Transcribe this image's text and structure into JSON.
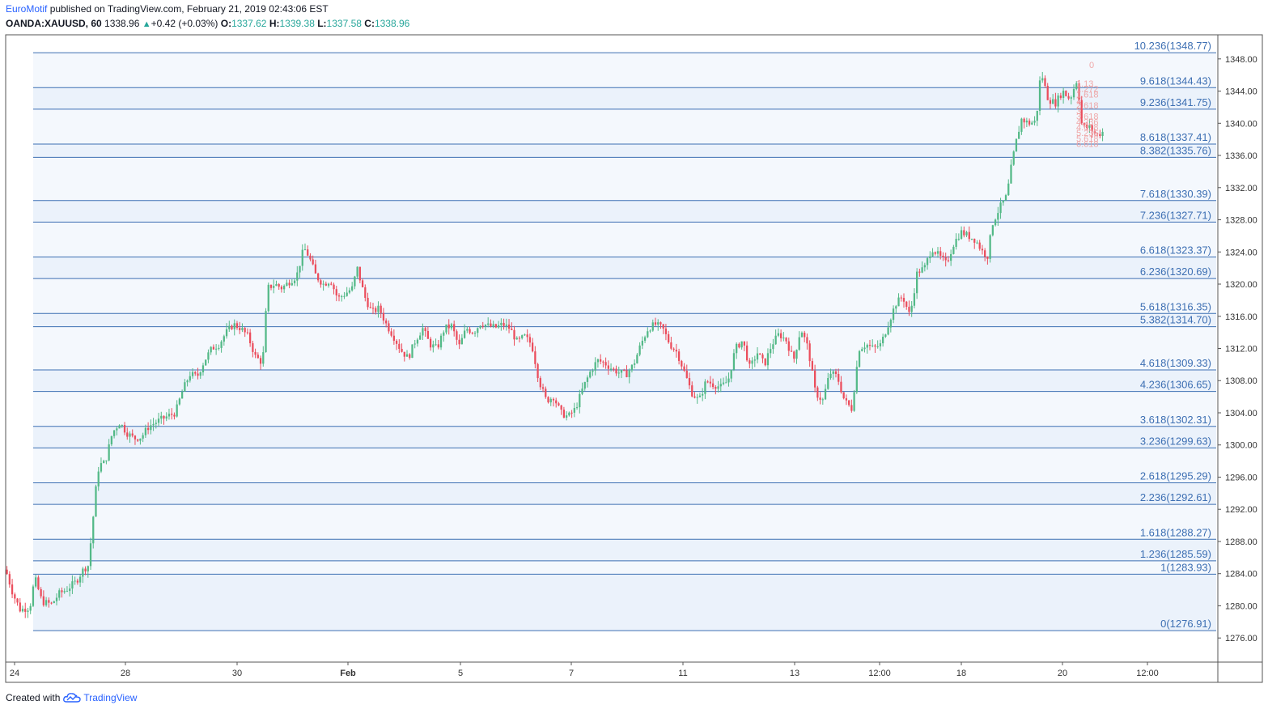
{
  "header": {
    "author": "EuroMotif",
    "published_text": " published on TradingView.com, February 21, 2019 02:43:06 EST",
    "symbol": "OANDA:XAUUSD, 60",
    "last": "1338.96",
    "change_arrow": "▲",
    "change": "+0.42 (+0.03%)",
    "o_label": "O:",
    "o": "1337.62",
    "h_label": "H:",
    "h": "1339.38",
    "l_label": "L:",
    "l": "1337.58",
    "c_label": "C:",
    "c": "1338.96"
  },
  "footer": {
    "created_with": "Created with",
    "brand": "TradingView"
  },
  "chart_data": {
    "type": "candlestick",
    "symbol": "OANDA:XAUUSD",
    "timeframe": "60",
    "ylim": [
      1273,
      1351
    ],
    "y_ticks": [
      "1276.00",
      "1280.00",
      "1284.00",
      "1288.00",
      "1292.00",
      "1296.00",
      "1300.00",
      "1304.00",
      "1308.00",
      "1312.00",
      "1316.00",
      "1320.00",
      "1324.00",
      "1328.00",
      "1332.00",
      "1336.00",
      "1340.00",
      "1344.00",
      "1348.00"
    ],
    "x_ticks": [
      "24",
      "28",
      "30",
      "Feb",
      "5",
      "7",
      "11",
      "13",
      "12:00",
      "18",
      "20",
      "12:00"
    ],
    "colors": {
      "up": "#53b987",
      "down": "#eb4d5c",
      "fib_line": "#3d6fb3",
      "fib_label": "#3d6fb3",
      "fib_fill": "#dbe8f7",
      "small_fib": "#ef9a9a"
    },
    "fib_levels": [
      {
        "ratio": "0",
        "price": 1276.91,
        "label": "0(1276.91)"
      },
      {
        "ratio": "1",
        "price": 1283.93,
        "label": "1(1283.93)"
      },
      {
        "ratio": "1.236",
        "price": 1285.59,
        "label": "1.236(1285.59)"
      },
      {
        "ratio": "1.618",
        "price": 1288.27,
        "label": "1.618(1288.27)"
      },
      {
        "ratio": "2.236",
        "price": 1292.61,
        "label": "2.236(1292.61)"
      },
      {
        "ratio": "2.618",
        "price": 1295.29,
        "label": "2.618(1295.29)"
      },
      {
        "ratio": "3.236",
        "price": 1299.63,
        "label": "3.236(1299.63)"
      },
      {
        "ratio": "3.618",
        "price": 1302.31,
        "label": "3.618(1302.31)"
      },
      {
        "ratio": "4.236",
        "price": 1306.65,
        "label": "4.236(1306.65)"
      },
      {
        "ratio": "4.618",
        "price": 1309.33,
        "label": "4.618(1309.33)"
      },
      {
        "ratio": "5.382",
        "price": 1314.7,
        "label": "5.382(1314.70)"
      },
      {
        "ratio": "5.618",
        "price": 1316.35,
        "label": "5.618(1316.35)"
      },
      {
        "ratio": "6.236",
        "price": 1320.69,
        "label": "6.236(1320.69)"
      },
      {
        "ratio": "6.618",
        "price": 1323.37,
        "label": "6.618(1323.37)"
      },
      {
        "ratio": "7.236",
        "price": 1327.71,
        "label": "7.236(1327.71)"
      },
      {
        "ratio": "7.618",
        "price": 1330.39,
        "label": "7.618(1330.39)"
      },
      {
        "ratio": "8.382",
        "price": 1335.76,
        "label": "8.382(1335.76)"
      },
      {
        "ratio": "8.618",
        "price": 1337.41,
        "label": "8.618(1337.41)"
      },
      {
        "ratio": "9.236",
        "price": 1341.75,
        "label": "9.236(1341.75)"
      },
      {
        "ratio": "9.618",
        "price": 1344.43,
        "label": "9.618(1344.43)"
      },
      {
        "ratio": "10.236",
        "price": 1348.77,
        "label": "10.236(1348.77)"
      }
    ],
    "small_fib_labels": [
      "0",
      "1.13",
      "1.272",
      "1.618",
      "2",
      "2.618",
      "3",
      "3.618",
      "4.236",
      "4.618",
      "5.236",
      "5.618",
      "6.618"
    ],
    "price_path": [
      {
        "x": 0.0,
        "y": 1284.5
      },
      {
        "x": 0.006,
        "y": 1281.5
      },
      {
        "x": 0.012,
        "y": 1279.5
      },
      {
        "x": 0.02,
        "y": 1279.8
      },
      {
        "x": 0.024,
        "y": 1283.5
      },
      {
        "x": 0.03,
        "y": 1280.5
      },
      {
        "x": 0.038,
        "y": 1280.2
      },
      {
        "x": 0.044,
        "y": 1281.5
      },
      {
        "x": 0.05,
        "y": 1282.0
      },
      {
        "x": 0.058,
        "y": 1283.0
      },
      {
        "x": 0.064,
        "y": 1284.5
      },
      {
        "x": 0.068,
        "y": 1285.0
      },
      {
        "x": 0.071,
        "y": 1289.0
      },
      {
        "x": 0.074,
        "y": 1294.0
      },
      {
        "x": 0.077,
        "y": 1297.5
      },
      {
        "x": 0.082,
        "y": 1297.8
      },
      {
        "x": 0.088,
        "y": 1301.5
      },
      {
        "x": 0.094,
        "y": 1302.8
      },
      {
        "x": 0.1,
        "y": 1301.5
      },
      {
        "x": 0.106,
        "y": 1300.8
      },
      {
        "x": 0.112,
        "y": 1301.0
      },
      {
        "x": 0.118,
        "y": 1302.3
      },
      {
        "x": 0.126,
        "y": 1303.0
      },
      {
        "x": 0.134,
        "y": 1303.6
      },
      {
        "x": 0.14,
        "y": 1304.0
      },
      {
        "x": 0.146,
        "y": 1306.8
      },
      {
        "x": 0.152,
        "y": 1308.8
      },
      {
        "x": 0.158,
        "y": 1308.5
      },
      {
        "x": 0.164,
        "y": 1310.5
      },
      {
        "x": 0.17,
        "y": 1312.0
      },
      {
        "x": 0.176,
        "y": 1312.5
      },
      {
        "x": 0.182,
        "y": 1314.0
      },
      {
        "x": 0.188,
        "y": 1315.0
      },
      {
        "x": 0.194,
        "y": 1314.5
      },
      {
        "x": 0.2,
        "y": 1313.5
      },
      {
        "x": 0.206,
        "y": 1311.0
      },
      {
        "x": 0.212,
        "y": 1310.2
      },
      {
        "x": 0.216,
        "y": 1319.5
      },
      {
        "x": 0.222,
        "y": 1320.0
      },
      {
        "x": 0.228,
        "y": 1319.5
      },
      {
        "x": 0.234,
        "y": 1320.3
      },
      {
        "x": 0.24,
        "y": 1321.0
      },
      {
        "x": 0.246,
        "y": 1324.5
      },
      {
        "x": 0.25,
        "y": 1323.5
      },
      {
        "x": 0.256,
        "y": 1321.0
      },
      {
        "x": 0.262,
        "y": 1320.0
      },
      {
        "x": 0.268,
        "y": 1320.5
      },
      {
        "x": 0.274,
        "y": 1318.2
      },
      {
        "x": 0.28,
        "y": 1318.8
      },
      {
        "x": 0.286,
        "y": 1319.5
      },
      {
        "x": 0.29,
        "y": 1322.0
      },
      {
        "x": 0.296,
        "y": 1318.5
      },
      {
        "x": 0.302,
        "y": 1316.5
      },
      {
        "x": 0.308,
        "y": 1317.0
      },
      {
        "x": 0.314,
        "y": 1315.0
      },
      {
        "x": 0.32,
        "y": 1313.5
      },
      {
        "x": 0.326,
        "y": 1311.8
      },
      {
        "x": 0.332,
        "y": 1310.8
      },
      {
        "x": 0.338,
        "y": 1313.0
      },
      {
        "x": 0.344,
        "y": 1314.5
      },
      {
        "x": 0.35,
        "y": 1312.5
      },
      {
        "x": 0.356,
        "y": 1312.0
      },
      {
        "x": 0.362,
        "y": 1314.5
      },
      {
        "x": 0.368,
        "y": 1314.8
      },
      {
        "x": 0.374,
        "y": 1312.2
      },
      {
        "x": 0.38,
        "y": 1314.5
      },
      {
        "x": 0.386,
        "y": 1314.0
      },
      {
        "x": 0.392,
        "y": 1315.2
      },
      {
        "x": 0.398,
        "y": 1314.8
      },
      {
        "x": 0.404,
        "y": 1314.6
      },
      {
        "x": 0.41,
        "y": 1315.0
      },
      {
        "x": 0.416,
        "y": 1314.5
      },
      {
        "x": 0.422,
        "y": 1312.8
      },
      {
        "x": 0.428,
        "y": 1313.5
      },
      {
        "x": 0.434,
        "y": 1312.5
      },
      {
        "x": 0.44,
        "y": 1308.0
      },
      {
        "x": 0.446,
        "y": 1305.5
      },
      {
        "x": 0.452,
        "y": 1306.0
      },
      {
        "x": 0.458,
        "y": 1304.0
      },
      {
        "x": 0.464,
        "y": 1303.5
      },
      {
        "x": 0.47,
        "y": 1304.5
      },
      {
        "x": 0.476,
        "y": 1307.0
      },
      {
        "x": 0.482,
        "y": 1309.0
      },
      {
        "x": 0.488,
        "y": 1310.5
      },
      {
        "x": 0.494,
        "y": 1310.2
      },
      {
        "x": 0.5,
        "y": 1309.5
      },
      {
        "x": 0.506,
        "y": 1309.0
      },
      {
        "x": 0.512,
        "y": 1308.8
      },
      {
        "x": 0.518,
        "y": 1310.0
      },
      {
        "x": 0.524,
        "y": 1312.5
      },
      {
        "x": 0.53,
        "y": 1314.5
      },
      {
        "x": 0.536,
        "y": 1315.0
      },
      {
        "x": 0.542,
        "y": 1314.5
      },
      {
        "x": 0.548,
        "y": 1312.5
      },
      {
        "x": 0.554,
        "y": 1311.5
      },
      {
        "x": 0.56,
        "y": 1309.0
      },
      {
        "x": 0.566,
        "y": 1306.5
      },
      {
        "x": 0.572,
        "y": 1305.5
      },
      {
        "x": 0.578,
        "y": 1308.0
      },
      {
        "x": 0.584,
        "y": 1307.5
      },
      {
        "x": 0.59,
        "y": 1307.2
      },
      {
        "x": 0.596,
        "y": 1308.0
      },
      {
        "x": 0.602,
        "y": 1312.0
      },
      {
        "x": 0.608,
        "y": 1313.0
      },
      {
        "x": 0.614,
        "y": 1309.5
      },
      {
        "x": 0.62,
        "y": 1311.5
      },
      {
        "x": 0.626,
        "y": 1310.0
      },
      {
        "x": 0.632,
        "y": 1312.5
      },
      {
        "x": 0.638,
        "y": 1313.8
      },
      {
        "x": 0.644,
        "y": 1313.0
      },
      {
        "x": 0.65,
        "y": 1310.5
      },
      {
        "x": 0.656,
        "y": 1314.5
      },
      {
        "x": 0.662,
        "y": 1312.0
      },
      {
        "x": 0.668,
        "y": 1306.5
      },
      {
        "x": 0.674,
        "y": 1305.5
      },
      {
        "x": 0.68,
        "y": 1309.0
      },
      {
        "x": 0.686,
        "y": 1308.5
      },
      {
        "x": 0.692,
        "y": 1305.5
      },
      {
        "x": 0.698,
        "y": 1304.5
      },
      {
        "x": 0.704,
        "y": 1312.0
      },
      {
        "x": 0.71,
        "y": 1312.5
      },
      {
        "x": 0.716,
        "y": 1312.0
      },
      {
        "x": 0.722,
        "y": 1312.5
      },
      {
        "x": 0.728,
        "y": 1315.0
      },
      {
        "x": 0.734,
        "y": 1317.5
      },
      {
        "x": 0.74,
        "y": 1318.5
      },
      {
        "x": 0.746,
        "y": 1316.0
      },
      {
        "x": 0.752,
        "y": 1321.5
      },
      {
        "x": 0.758,
        "y": 1322.0
      },
      {
        "x": 0.764,
        "y": 1324.5
      },
      {
        "x": 0.77,
        "y": 1323.5
      },
      {
        "x": 0.776,
        "y": 1322.5
      },
      {
        "x": 0.782,
        "y": 1325.0
      },
      {
        "x": 0.788,
        "y": 1326.5
      },
      {
        "x": 0.794,
        "y": 1326.0
      },
      {
        "x": 0.8,
        "y": 1325.5
      },
      {
        "x": 0.806,
        "y": 1324.0
      },
      {
        "x": 0.81,
        "y": 1323.5
      },
      {
        "x": 0.814,
        "y": 1327.5
      },
      {
        "x": 0.82,
        "y": 1329.5
      },
      {
        "x": 0.826,
        "y": 1331.0
      },
      {
        "x": 0.83,
        "y": 1335.0
      },
      {
        "x": 0.834,
        "y": 1338.0
      },
      {
        "x": 0.838,
        "y": 1340.5
      },
      {
        "x": 0.844,
        "y": 1340.0
      },
      {
        "x": 0.85,
        "y": 1340.2
      },
      {
        "x": 0.854,
        "y": 1346.5
      },
      {
        "x": 0.86,
        "y": 1343.0
      },
      {
        "x": 0.866,
        "y": 1342.5
      },
      {
        "x": 0.872,
        "y": 1344.0
      },
      {
        "x": 0.878,
        "y": 1343.0
      },
      {
        "x": 0.884,
        "y": 1345.5
      },
      {
        "x": 0.888,
        "y": 1339.5
      },
      {
        "x": 0.894,
        "y": 1339.5
      },
      {
        "x": 0.9,
        "y": 1338.5
      },
      {
        "x": 0.906,
        "y": 1339.0
      }
    ]
  }
}
